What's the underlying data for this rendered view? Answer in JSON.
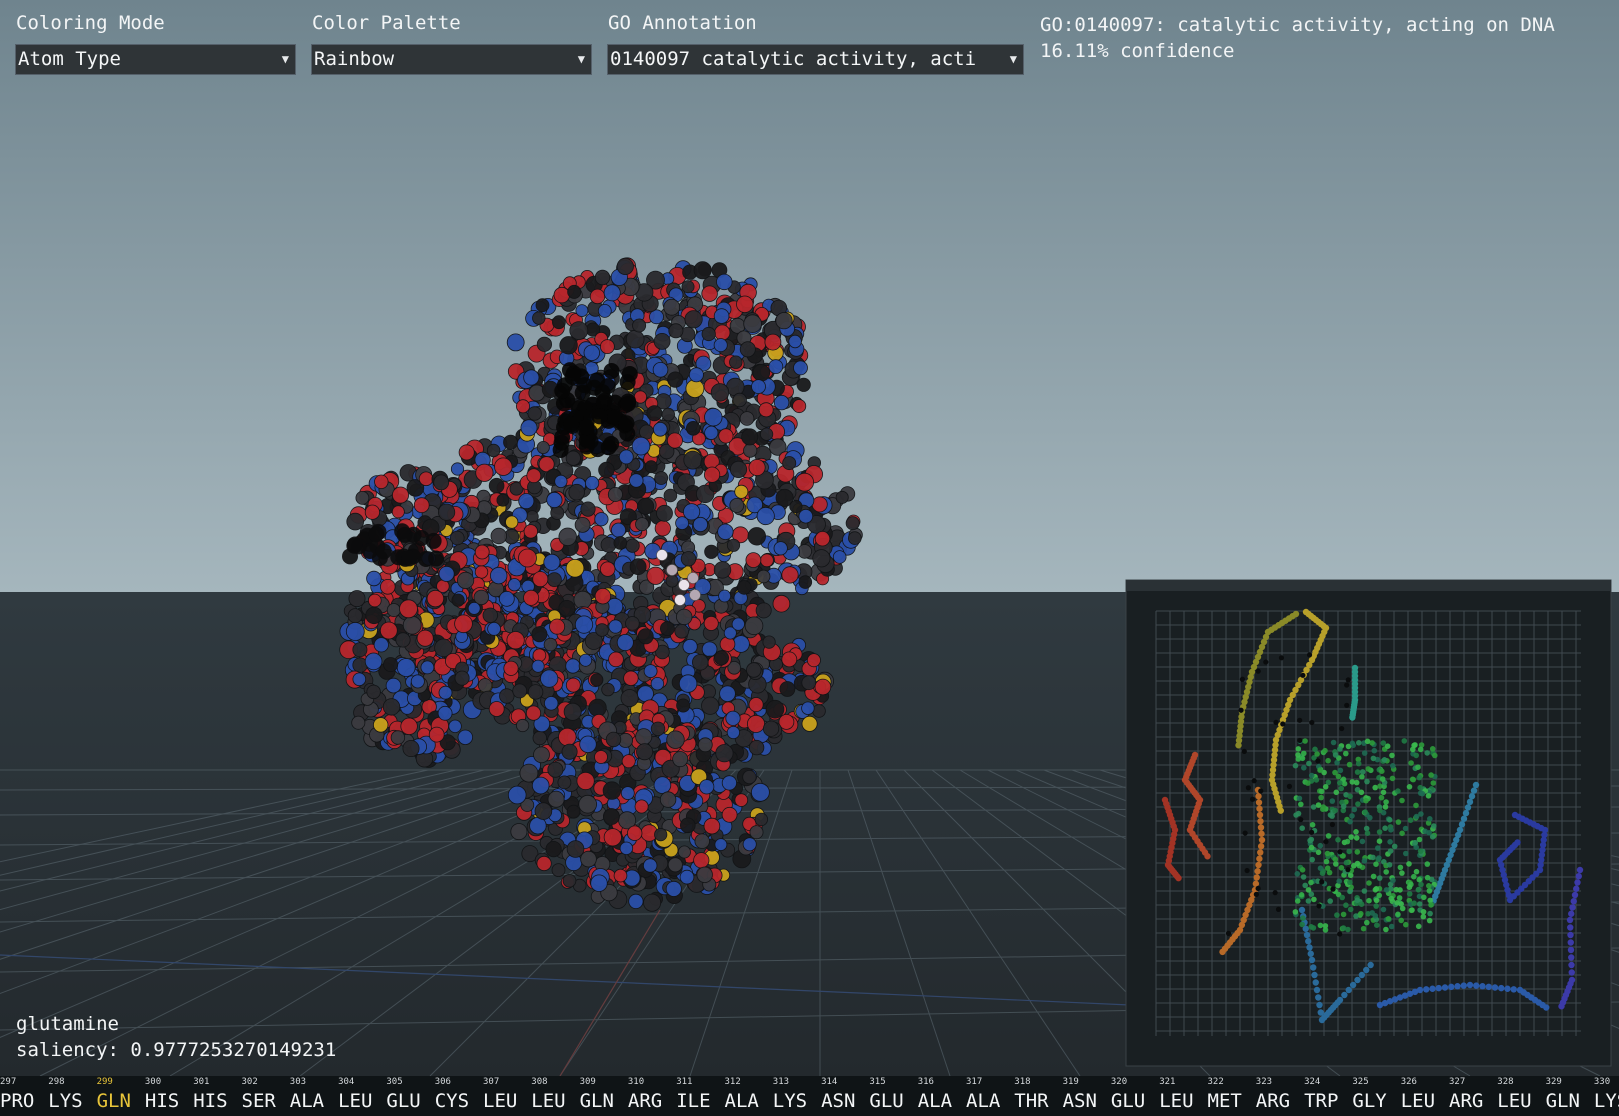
{
  "controls": {
    "coloring_mode": {
      "label": "Coloring Mode",
      "value": "Atom Type"
    },
    "color_palette": {
      "label": "Color Palette",
      "value": "Rainbow"
    },
    "go_annotation": {
      "label": "GO Annotation",
      "value": "0140097 catalytic activity, acti"
    }
  },
  "go_info": {
    "title": "GO:0140097: catalytic activity, acting on DNA",
    "confidence": "16.11% confidence"
  },
  "hover": {
    "residue": "glutamine",
    "saliency": "saliency: 0.9777253270149231"
  },
  "sequence": {
    "highlight_index": 2,
    "numbers": [
      "297",
      "298",
      "299",
      "300",
      "301",
      "302",
      "303",
      "304",
      "305",
      "306",
      "307",
      "308",
      "309",
      "310",
      "311",
      "312",
      "313",
      "314",
      "315",
      "316",
      "317",
      "318",
      "319",
      "320",
      "321",
      "322",
      "323",
      "324",
      "325",
      "326",
      "327",
      "328",
      "329",
      "330"
    ],
    "residues": [
      "PRO",
      "LYS",
      "GLN",
      "HIS",
      "HIS",
      "SER",
      "ALA",
      "LEU",
      "GLU",
      "CYS",
      "LEU",
      "LEU",
      "GLN",
      "ARG",
      "ILE",
      "ALA",
      "LYS",
      "ASN",
      "GLU",
      "ALA",
      "ALA",
      "THR",
      "ASN",
      "GLU",
      "LEU",
      "MET",
      "ARG",
      "TRP",
      "GLY",
      "LEU",
      "ARG",
      "LEU",
      "GLN",
      "LYS"
    ]
  },
  "colors": {
    "sky_top": "#6f848e",
    "sky_bottom": "#a5b6bd",
    "ground": "#2c3338",
    "atom_red": "#b8262c",
    "atom_blue": "#2a4fa8",
    "atom_dark": "#2a2a2e",
    "atom_yellow": "#c9a21c",
    "highlight": "#e8c53a"
  },
  "icons": {
    "select_arrow": "dropdown-triangle-icon"
  }
}
